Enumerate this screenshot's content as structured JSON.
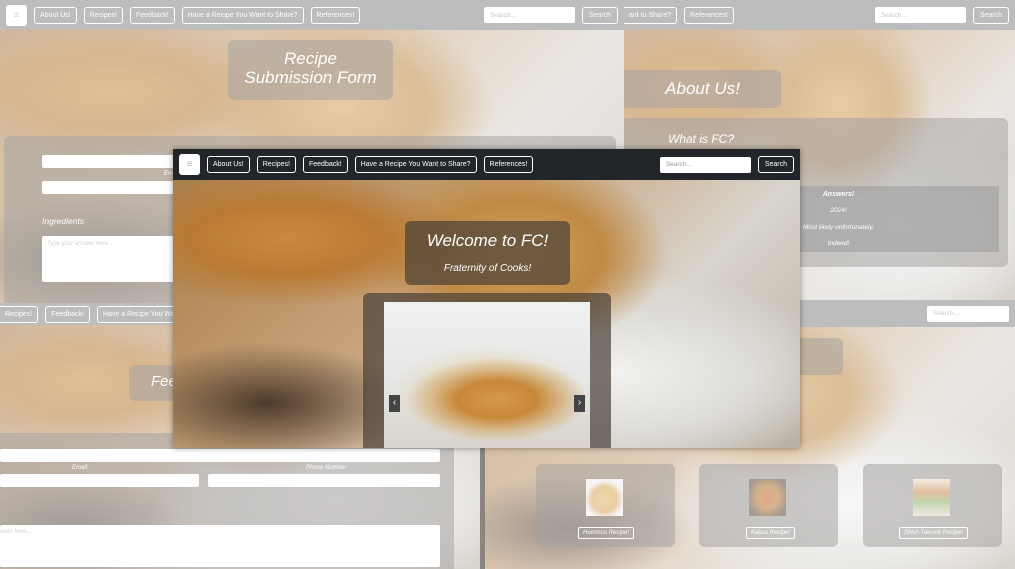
{
  "nav": {
    "items": [
      "About Us!",
      "Recipes!",
      "Feedback!",
      "Have a Recipe You Want to Share?",
      "References!"
    ],
    "search_placeholder": "Search...",
    "search_button": "Search",
    "toggler_icon": "hamburger-icon"
  },
  "nav_partial": {
    "share_cut": "ant to Share?",
    "references": "References!",
    "recipes_cut": "Recipes!",
    "feedback": "Feedback!",
    "share_cut2": "Have a Recipe You Want to Share?"
  },
  "submission": {
    "title": "Recipe Submission Form",
    "name_label_cut": "Em",
    "ingredients_label": "Ingredients",
    "answer_placeholder": "Type your answer here..."
  },
  "about": {
    "title": "About Us!",
    "subtitle": "What is FC?",
    "table": [
      "Answers!",
      "2024!",
      "Most likely unfortunately.",
      "Indeed!"
    ]
  },
  "feedback": {
    "title_cut": "Fee",
    "email_label": "Email:",
    "phone_label": "Phone Number:",
    "answer_placeholder_cut": "swer here..."
  },
  "recipes": {
    "cards": [
      {
        "label": "Hummus Recipe!",
        "icon": "hummus-thumbnail"
      },
      {
        "label": "Kabsa Recipe!",
        "icon": "kabsa-thumbnail"
      },
      {
        "label": "Shish Tawook Recipe!",
        "icon": "shish-tawook-thumbnail"
      }
    ]
  },
  "home": {
    "title": "Welcome to FC!",
    "subtitle": "Fraternity of Cooks!",
    "carousel_prev": "‹",
    "carousel_next": "›"
  }
}
